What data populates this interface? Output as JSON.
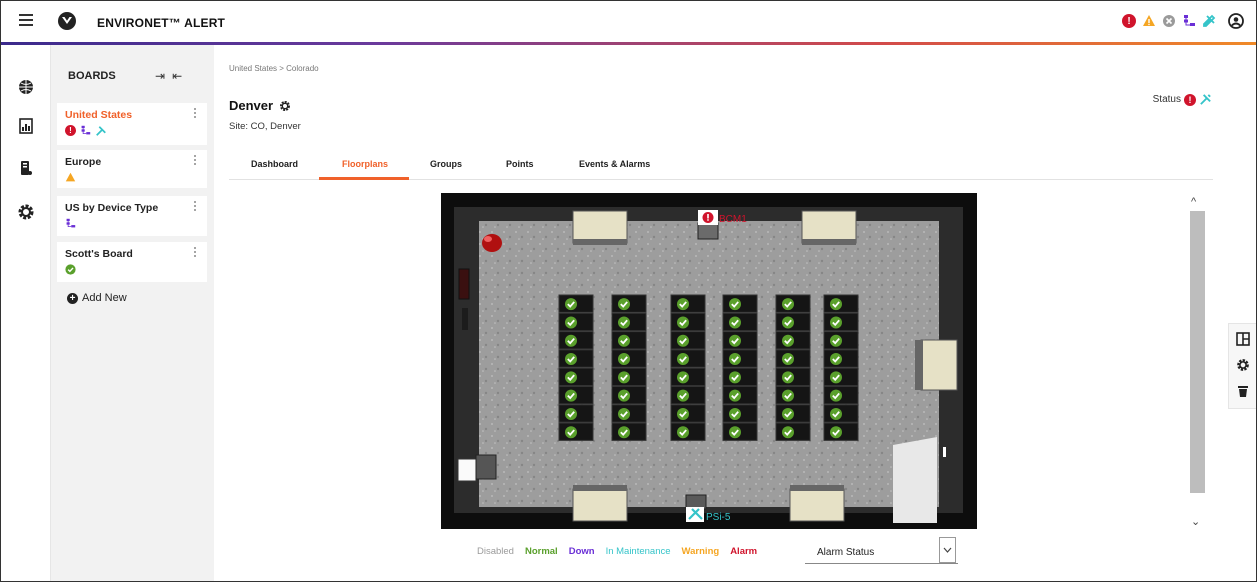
{
  "app": {
    "title": "ENVIRONET™ ALERT"
  },
  "header_icons": [
    "alarm-icon",
    "warning-icon",
    "disabled-icon",
    "down-icon",
    "maintenance-icon",
    "user-icon"
  ],
  "boards": {
    "heading": "BOARDS",
    "items": [
      {
        "label": "United States",
        "active": true,
        "icons": [
          "alarm-icon",
          "down-icon",
          "maintenance-icon"
        ]
      },
      {
        "label": "Europe",
        "icons": [
          "warning-icon"
        ]
      },
      {
        "label": "US by Device Type",
        "icons": [
          "down-icon"
        ]
      },
      {
        "label": "Scott's Board",
        "icons": [
          "normal-icon"
        ]
      }
    ],
    "add_new": "Add New"
  },
  "breadcrumb": "United States > Colorado",
  "page": {
    "title": "Denver",
    "site": "Site: CO, Denver",
    "status_label": "Status"
  },
  "tabs": [
    "Dashboard",
    "Floorplans",
    "Groups",
    "Points",
    "Events & Alarms"
  ],
  "active_tab": "Floorplans",
  "floorplan": {
    "labels": {
      "bcm": "BCM1",
      "psi": "PSi-5"
    },
    "rack_columns": 6,
    "racks_per_column": 8,
    "rack_status": "normal"
  },
  "legend": [
    {
      "label": "Disabled",
      "color": "#9a9a9a"
    },
    {
      "label": "Normal",
      "color": "#5aa02c"
    },
    {
      "label": "Down",
      "color": "#6a2fd6"
    },
    {
      "label": "In Maintenance",
      "color": "#35c4c9"
    },
    {
      "label": "Warning",
      "color": "#f5a623"
    },
    {
      "label": "Alarm",
      "color": "#d0142c"
    }
  ],
  "status_select": {
    "value": "Alarm Status"
  },
  "colors": {
    "accent": "#f0612a",
    "alarm": "#d0142c",
    "warning": "#f5a623",
    "normal": "#5aa02c",
    "down": "#6a2fd6",
    "maintenance": "#35c4c9"
  }
}
